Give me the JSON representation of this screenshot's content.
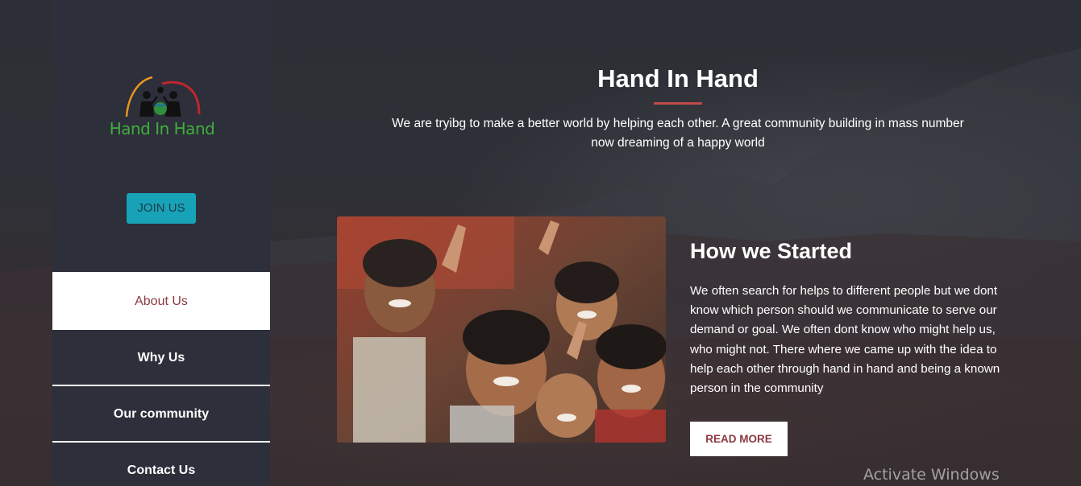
{
  "sidebar": {
    "logo_text": "Hand In Hand",
    "join_label": "JOIN US",
    "nav": [
      {
        "label": "About Us"
      },
      {
        "label": "Why Us"
      },
      {
        "label": "Our community"
      },
      {
        "label": "Contact Us"
      }
    ]
  },
  "hero": {
    "title": "Hand In Hand",
    "description": "We are tryibg to make a better world by helping each other. A great community building in mass number now dreaming of a happy world"
  },
  "story": {
    "title": "How we Started",
    "text": "We often search for helps to different people but we dont know which person should we communicate to serve our demand or goal. We often dont know who might help us, who might not. There where we came up with the idea to help each other through hand in hand and being a known person in the community",
    "button_label": "READ MORE"
  },
  "watermark": "Activate Windows",
  "colors": {
    "accent_red": "#8a3a3f",
    "join_button": "#17a2b8",
    "underline": "#c24a4a",
    "logo_green": "#3fae3c",
    "sidebar_bg": "#2d2f3a"
  },
  "icons": {
    "logo": "children-holding-hands-globe-logo"
  }
}
